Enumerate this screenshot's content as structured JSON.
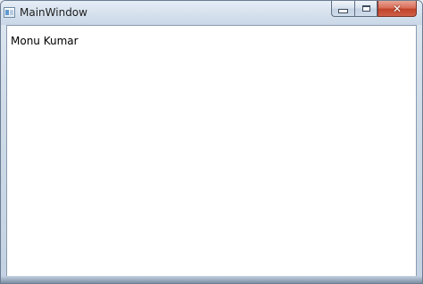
{
  "window": {
    "title": "MainWindow",
    "icon": "application-window-icon",
    "caption_buttons": {
      "minimize": "minimize-icon",
      "maximize": "maximize-icon",
      "close": "close-icon",
      "close_glyph": "✕"
    }
  },
  "content": {
    "label": "Monu Kumar"
  },
  "colors": {
    "close_button": "#c8462f",
    "client_background": "#ffffff"
  }
}
